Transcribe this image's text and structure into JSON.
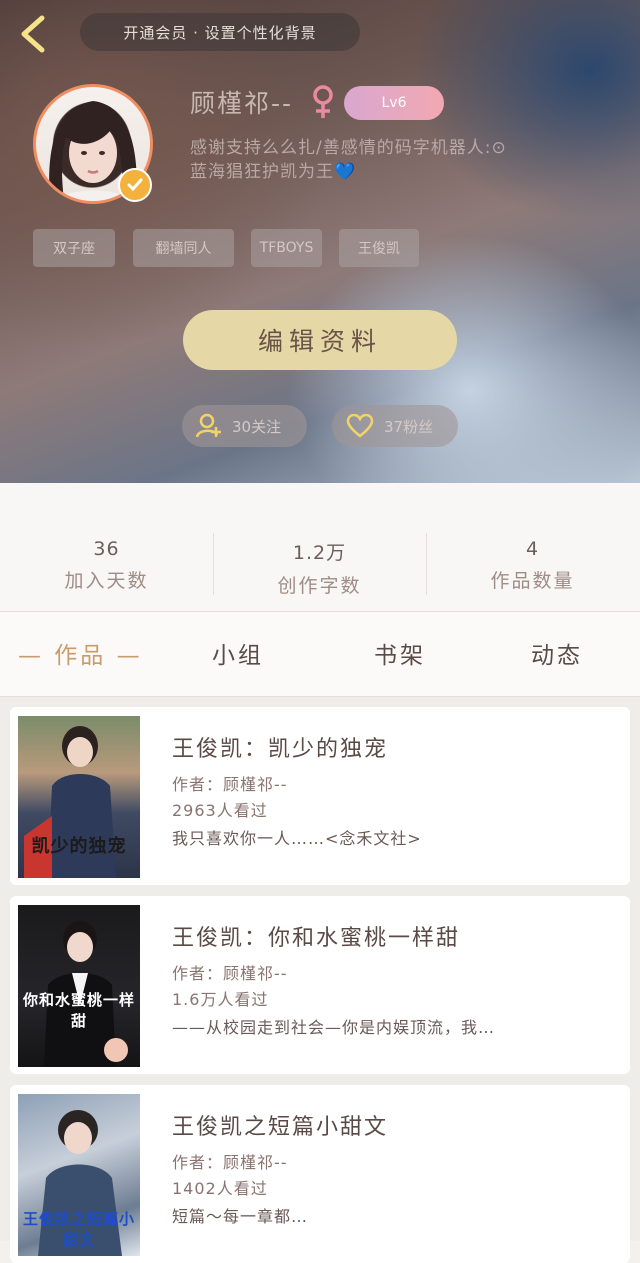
{
  "header": {
    "vip_banner": "开通会员 · 设置个性化背景",
    "username": "顾槿祁--",
    "level": "Lv6",
    "bio_line1": "感谢支持么么扎/善感情的码字机器人:⊙",
    "bio_line2": "蓝海猖狂护凯为王",
    "bio_heart": "💙",
    "tags": [
      "双子座",
      "翻墙同人",
      "TFBOYS",
      "王俊凯"
    ],
    "edit_label": "编辑资料",
    "following": "30关注",
    "fans": "37粉丝"
  },
  "stats": [
    {
      "value": "36",
      "label": "加入天数"
    },
    {
      "value": "1.2万",
      "label": "创作字数"
    },
    {
      "value": "4",
      "label": "作品数量"
    }
  ],
  "tabs": [
    "— 作品 —",
    "小组",
    "书架",
    "动态"
  ],
  "works": [
    {
      "title": "王俊凯：凯少的独宠",
      "author": "作者：顾槿祁--",
      "views": "2963人看过",
      "desc": "我只喜欢你一人……<念禾文社>",
      "cover_text": "凯少的独宠"
    },
    {
      "title": "王俊凯：你和水蜜桃一样甜",
      "author": "作者：顾槿祁--",
      "views": "1.6万人看过",
      "desc": "——从校园走到社会—你是内娱顶流，我…",
      "cover_text": "你和水蜜桃一样甜"
    },
    {
      "title": "王俊凯之短篇小甜文",
      "author": "作者：顾槿祁--",
      "views": "1402人看过",
      "desc": "短篇～每一章都…",
      "cover_text": "王俊凯之短篇小甜文"
    }
  ],
  "colors": {
    "accent_gold": "#e6d7a6",
    "tab_active": "#c99b6a",
    "avatar_ring": "#f08e62",
    "verify_badge": "#f2b23c"
  }
}
